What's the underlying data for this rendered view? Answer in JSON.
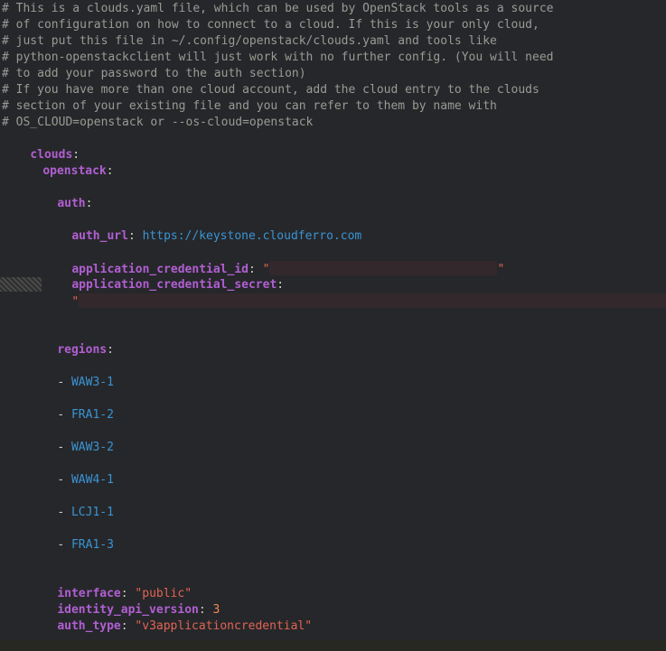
{
  "comments": [
    "# This is a clouds.yaml file, which can be used by OpenStack tools as a source",
    "# of configuration on how to connect to a cloud. If this is your only cloud,",
    "# just put this file in ~/.config/openstack/clouds.yaml and tools like",
    "# python-openstackclient will just work with no further config. (You will need",
    "# to add your password to the auth section)",
    "# If you have more than one cloud account, add the cloud entry to the clouds",
    "# section of your existing file and you can refer to them by name with",
    "# OS_CLOUD=openstack or --os-cloud=openstack"
  ],
  "yaml": {
    "clouds_key": "clouds",
    "cloud_name": "openstack",
    "auth_key": "auth",
    "auth_url_key": "auth_url",
    "auth_url_value": "https://keystone.cloudferro.com",
    "app_cred_id_key": "application_credential_id",
    "app_cred_secret_key": "application_credential_secret",
    "quote": "\"",
    "regions_key": "regions",
    "regions": [
      "WAW3-1",
      "FRA1-2",
      "WAW3-2",
      "WAW4-1",
      "LCJ1-1",
      "FRA1-3"
    ],
    "interface_key": "interface",
    "interface_value": "\"public\"",
    "identity_api_version_key": "identity_api_version",
    "identity_api_version_value": "3",
    "auth_type_key": "auth_type",
    "auth_type_value": "\"v3applicationcredential\""
  },
  "punct": {
    "colon": ":",
    "colon_space": ": ",
    "dash": "- "
  }
}
